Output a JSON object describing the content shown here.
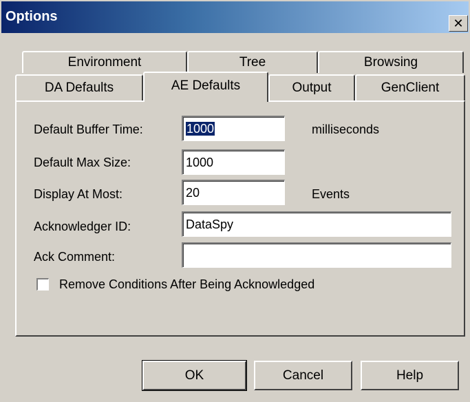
{
  "window": {
    "title": "Options",
    "close_label": "✕"
  },
  "tabs": {
    "row1": [
      "Environment",
      "Tree",
      "Browsing"
    ],
    "row2": [
      "DA Defaults",
      "AE Defaults",
      "Output",
      "GenClient"
    ],
    "active": "AE Defaults"
  },
  "form": {
    "buffer_time_label": "Default Buffer Time:",
    "buffer_time_value": "1000",
    "buffer_time_unit": "milliseconds",
    "max_size_label": "Default Max Size:",
    "max_size_value": "1000",
    "display_at_most_label": "Display At Most:",
    "display_at_most_value": "20",
    "display_at_most_unit": "Events",
    "acknowledger_id_label": "Acknowledger ID:",
    "acknowledger_id_value": "DataSpy",
    "ack_comment_label": "Ack Comment:",
    "ack_comment_value": "",
    "remove_conditions_label": "Remove Conditions After Being Acknowledged",
    "remove_conditions_checked": false
  },
  "buttons": {
    "ok": "OK",
    "cancel": "Cancel",
    "help": "Help"
  },
  "colors": {
    "title_bar_start": "#0a246a",
    "title_bar_end": "#a6caf0",
    "dialog_face": "#d4d0c8",
    "selection": "#0a246a"
  }
}
